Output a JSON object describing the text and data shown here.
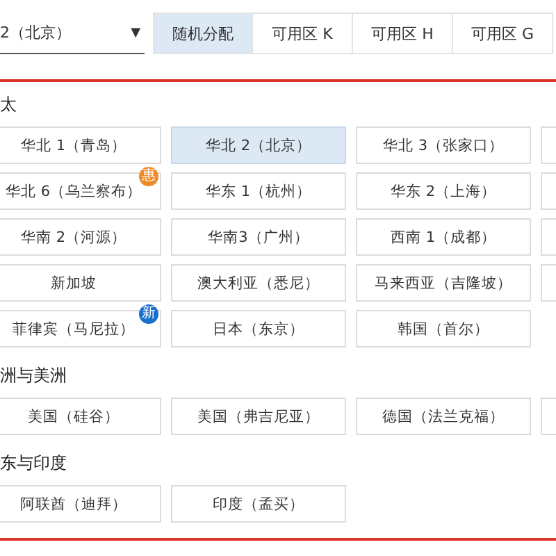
{
  "region_select": {
    "value": "2（北京）",
    "arrow": "▼"
  },
  "zone_tabs": [
    {
      "label": "随机分配",
      "selected": true
    },
    {
      "label": "可用区 K",
      "selected": false
    },
    {
      "label": "可用区 H",
      "selected": false
    },
    {
      "label": "可用区 G",
      "selected": false
    }
  ],
  "sections": [
    {
      "heading": "太",
      "rows": [
        [
          {
            "kind": "option",
            "label": "华北 1（青岛）",
            "selected": false
          },
          {
            "kind": "option",
            "label": "华北 2（北京）",
            "selected": true
          },
          {
            "kind": "option",
            "label": "华北 3（张家口）",
            "selected": false
          },
          {
            "kind": "partial"
          }
        ],
        [
          {
            "kind": "option",
            "label": "华北 6（乌兰察布）",
            "selected": false,
            "badge": {
              "text": "惠",
              "color": "#f08a24"
            }
          },
          {
            "kind": "option",
            "label": "华东 1（杭州）",
            "selected": false
          },
          {
            "kind": "option",
            "label": "华东 2（上海）",
            "selected": false
          },
          {
            "kind": "partial"
          }
        ],
        [
          {
            "kind": "option",
            "label": "华南 2（河源）",
            "selected": false
          },
          {
            "kind": "option",
            "label": "华南3（广州）",
            "selected": false
          },
          {
            "kind": "option",
            "label": "西南 1（成都）",
            "selected": false
          },
          {
            "kind": "partial"
          }
        ],
        [
          {
            "kind": "option",
            "label": "新加坡",
            "selected": false
          },
          {
            "kind": "option",
            "label": "澳大利亚（悉尼）",
            "selected": false
          },
          {
            "kind": "option",
            "label": "马来西亚（吉隆坡）",
            "selected": false
          },
          {
            "kind": "partial"
          }
        ],
        [
          {
            "kind": "option",
            "label": "菲律宾（马尼拉）",
            "selected": false,
            "badge": {
              "text": "新",
              "color": "#1a6fc9"
            }
          },
          {
            "kind": "option",
            "label": "日本（东京）",
            "selected": false
          },
          {
            "kind": "option",
            "label": "韩国（首尔）",
            "selected": false
          }
        ]
      ]
    },
    {
      "heading": "洲与美洲",
      "rows": [
        [
          {
            "kind": "option",
            "label": "美国（硅谷）",
            "selected": false
          },
          {
            "kind": "option",
            "label": "美国（弗吉尼亚）",
            "selected": false
          },
          {
            "kind": "option",
            "label": "德国（法兰克福）",
            "selected": false
          },
          {
            "kind": "partial"
          }
        ]
      ]
    },
    {
      "heading": "东与印度",
      "rows": [
        [
          {
            "kind": "option",
            "label": "阿联酋（迪拜）",
            "selected": false
          },
          {
            "kind": "option",
            "label": "印度（孟买）",
            "selected": false
          }
        ]
      ]
    }
  ]
}
